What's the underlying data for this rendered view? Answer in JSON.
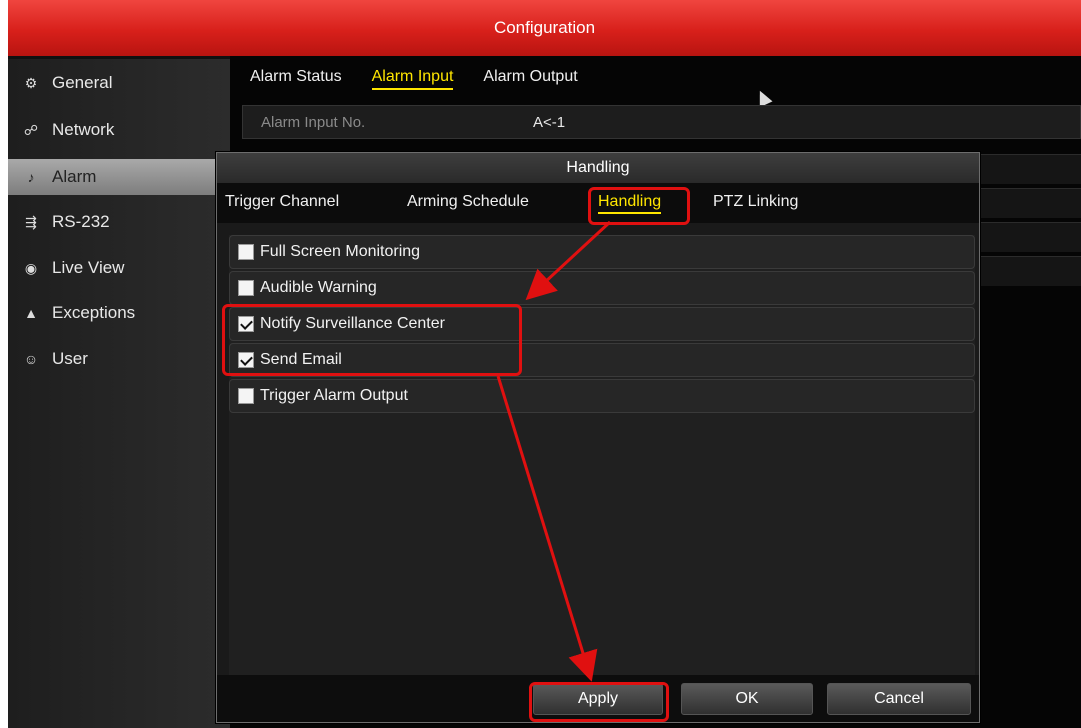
{
  "window": {
    "title": "Configuration"
  },
  "sidebar": {
    "items": [
      {
        "label": "General",
        "icon": "gear-icon"
      },
      {
        "label": "Network",
        "icon": "network-icon"
      },
      {
        "label": "Alarm",
        "icon": "alarm-bell-icon",
        "selected": true
      },
      {
        "label": "RS-232",
        "icon": "serial-port-icon"
      },
      {
        "label": "Live View",
        "icon": "eye-icon"
      },
      {
        "label": "Exceptions",
        "icon": "warning-triangle-icon"
      },
      {
        "label": "User",
        "icon": "users-icon"
      }
    ]
  },
  "main": {
    "tabs": [
      {
        "label": "Alarm Status"
      },
      {
        "label": "Alarm Input",
        "active": true
      },
      {
        "label": "Alarm Output"
      }
    ],
    "field": {
      "label": "Alarm Input No.",
      "value": "A<-1"
    }
  },
  "dialog": {
    "title": "Handling",
    "tabs": [
      {
        "label": "Trigger Channel"
      },
      {
        "label": "Arming Schedule"
      },
      {
        "label": "Handling",
        "active": true
      },
      {
        "label": "PTZ Linking"
      }
    ],
    "options": [
      {
        "label": "Full Screen Monitoring",
        "checked": false
      },
      {
        "label": "Audible Warning",
        "checked": false
      },
      {
        "label": "Notify Surveillance Center",
        "checked": true
      },
      {
        "label": "Send Email",
        "checked": true
      },
      {
        "label": "Trigger Alarm Output",
        "checked": false
      }
    ],
    "buttons": {
      "apply": "Apply",
      "ok": "OK",
      "cancel": "Cancel"
    }
  },
  "colors": {
    "accent_red": "#e01010",
    "active_tab": "#ffe600",
    "titlebar": "#d8201b"
  }
}
